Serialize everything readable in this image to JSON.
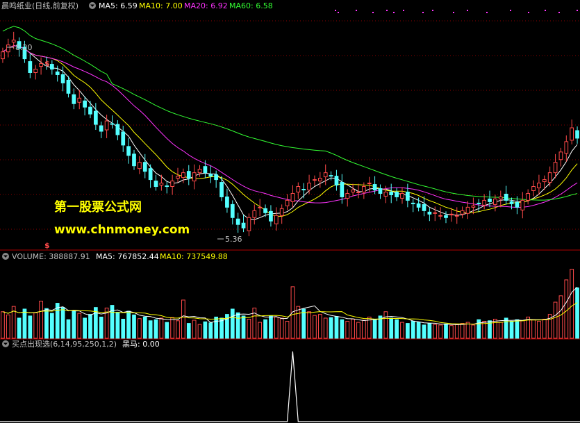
{
  "colors": {
    "background": "#000000",
    "up": "#ff4a4a",
    "down": "#54ffff",
    "ma5": "#ffffff",
    "ma10": "#ffff00",
    "ma20": "#ff33ff",
    "ma60": "#33ff33",
    "grid": "#8b0000",
    "header_label": "#c0c0c0",
    "watermark": "#ffff00",
    "signal": "#ffffff",
    "dots": "#ff33ff"
  },
  "price_panel": {
    "title": "晨鸣纸业(日线,前复权)",
    "ma_labels": [
      {
        "label": "MA5:",
        "value": "6.59",
        "color": "#ffffff"
      },
      {
        "label": "MA10:",
        "value": "7.00",
        "color": "#ffff00"
      },
      {
        "label": "MA20:",
        "value": "6.92",
        "color": "#ff33ff"
      },
      {
        "label": "MA60:",
        "value": "6.58",
        "color": "#33ff33"
      }
    ],
    "high_label": "8.20",
    "low_label": "5.36",
    "dollar_mark": "$",
    "watermark_line1": "第一股票公式网",
    "watermark_line2": "www.chnmoney.com"
  },
  "volume_panel": {
    "label": "VOLUME:",
    "value": "388887.91",
    "ma5_label": "MA5:",
    "ma5_value": "767852.44",
    "ma10_label": "MA10:",
    "ma10_value": "737549.88"
  },
  "indicator_panel": {
    "title": "买点出现选(6,14,95,250,1,2)",
    "series_label": "黑马:",
    "series_value": "0.00"
  },
  "chart_data": [
    {
      "type": "candlestick",
      "price_range": [
        5.1,
        8.5
      ],
      "high_label": 8.2,
      "low_label": 5.36,
      "closes": [
        7.95,
        8.05,
        8.12,
        8.0,
        7.85,
        7.65,
        7.7,
        7.78,
        7.75,
        7.7,
        7.62,
        7.5,
        7.35,
        7.2,
        7.28,
        7.15,
        7.05,
        6.9,
        6.8,
        6.95,
        6.9,
        6.75,
        6.6,
        6.45,
        6.3,
        6.35,
        6.22,
        6.1,
        6.0,
        6.05,
        6.0,
        6.08,
        6.15,
        6.2,
        6.12,
        6.2,
        6.25,
        6.2,
        6.15,
        6.1,
        5.85,
        5.7,
        5.55,
        5.45,
        5.4,
        5.55,
        5.65,
        5.7,
        5.62,
        5.5,
        5.58,
        5.68,
        5.8,
        5.9,
        6.0,
        5.95,
        6.05,
        6.1,
        6.12,
        6.2,
        6.15,
        6.02,
        5.85,
        5.9,
        5.95,
        5.92,
        6.0,
        6.05,
        5.95,
        5.9,
        5.92,
        5.88,
        5.85,
        5.9,
        5.8,
        5.75,
        5.7,
        5.65,
        5.6,
        5.62,
        5.58,
        5.55,
        5.6,
        5.58,
        5.65,
        5.7,
        5.72,
        5.75,
        5.8,
        5.78,
        5.82,
        5.85,
        5.8,
        5.75,
        5.7,
        5.8,
        5.9,
        6.0,
        6.05,
        6.1,
        6.2,
        6.35,
        6.5,
        6.65,
        6.85,
        6.7
      ],
      "ma_periods": [
        5,
        10,
        20,
        60
      ]
    },
    {
      "type": "bar",
      "name": "VOLUME",
      "volumes": [
        50,
        44,
        60,
        38,
        55,
        42,
        48,
        70,
        56,
        47,
        66,
        58,
        35,
        52,
        47,
        38,
        45,
        58,
        40,
        57,
        62,
        49,
        36,
        51,
        44,
        37,
        40,
        33,
        35,
        38,
        30,
        39,
        33,
        72,
        28,
        34,
        26,
        31,
        29,
        40,
        38,
        45,
        55,
        48,
        42,
        36,
        57,
        30,
        35,
        42,
        40,
        38,
        32,
        97,
        60,
        55,
        50,
        43,
        45,
        38,
        39,
        41,
        35,
        32,
        36,
        30,
        34,
        40,
        36,
        42,
        50,
        38,
        35,
        30,
        28,
        32,
        30,
        25,
        28,
        26,
        25,
        27,
        24,
        26,
        28,
        30,
        25,
        35,
        32,
        33,
        36,
        30,
        38,
        32,
        35,
        33,
        40,
        35,
        32,
        36,
        45,
        68,
        80,
        110,
        130,
        95
      ],
      "ylim": [
        0,
        140
      ]
    },
    {
      "type": "line",
      "name": "黑马",
      "spike_index": 53,
      "ylim": [
        0,
        1
      ]
    }
  ]
}
